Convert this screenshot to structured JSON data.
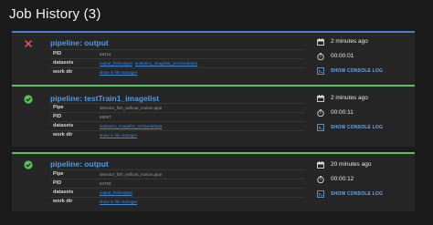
{
  "page": {
    "title": "Job History (3)"
  },
  "jobs": [
    {
      "status": "failed",
      "status_icon": "close-icon",
      "pipeline": "pipeline: output",
      "rows": [
        {
          "key": "PID",
          "value": "69416"
        },
        {
          "key": "datasets",
          "links": [
            "output_fish/output",
            "testtrain1_imagelist_archived/data"
          ]
        },
        {
          "key": "work dir",
          "link": "show in file manager"
        }
      ],
      "time_ago": "2 minutes ago",
      "duration": "00:00:01",
      "console_label": "SHOW CONSOLE LOG"
    },
    {
      "status": "success",
      "status_icon": "check-circle-icon",
      "pipeline": "pipeline: testTrain1_imagelist",
      "rows": [
        {
          "key": "Pipe",
          "value": "detector_fish_without_motion.pipe"
        },
        {
          "key": "PID",
          "value": "69087"
        },
        {
          "key": "datasets",
          "links": [
            "testtrain1_imagelist_archived/data"
          ]
        },
        {
          "key": "work dir",
          "link": "show in file manager"
        }
      ],
      "time_ago": "2 minutes ago",
      "duration": "00:00:11",
      "console_label": "SHOW CONSOLE LOG"
    },
    {
      "status": "success",
      "status_icon": "check-circle-icon",
      "pipeline": "pipeline: output",
      "rows": [
        {
          "key": "Pipe",
          "value": "detector_fish_without_motion.pipe"
        },
        {
          "key": "PID",
          "value": "64758"
        },
        {
          "key": "datasets",
          "links": [
            "output_fish/output"
          ]
        },
        {
          "key": "work dir",
          "link": "show in file manager"
        }
      ],
      "time_ago": "20 minutes ago",
      "duration": "00:00:12",
      "console_label": "SHOW CONSOLE LOG"
    }
  ],
  "colors": {
    "accent_blue": "#4c7fcf",
    "accent_green": "#56c25a",
    "error_red": "#e05050",
    "link": "#3c8ad9"
  }
}
